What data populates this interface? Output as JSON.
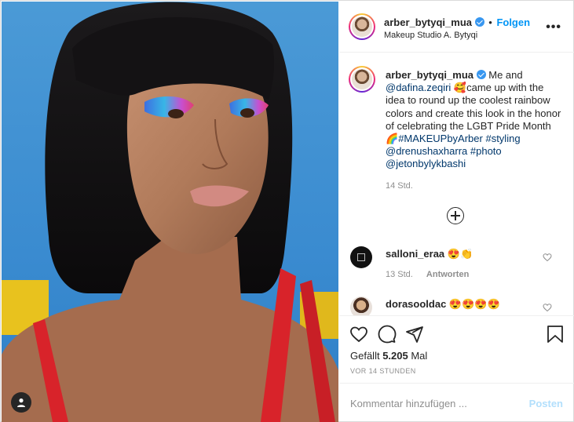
{
  "colors": {
    "accent": "#0095f6",
    "link": "#00376b",
    "muted": "#8e8e8e",
    "post_disabled": "#b2dffc",
    "photo_background": "#3b8fd0"
  },
  "header": {
    "username": "arber_bytyqi_mua",
    "verified_icon": "verified-badge-icon",
    "separator": "•",
    "follow_label": "Folgen",
    "location": "Makeup Studio A. Bytyqi",
    "more_label": "•••"
  },
  "caption": {
    "username": "arber_bytyqi_mua",
    "text_1": " Me and ",
    "mention_1": "@dafina.zeqiri",
    "emoji_1": "🥰",
    "text_2": "came up with the idea to round up the coolest rainbow colors and create this look in the honor of celebrating the LGBT Pride Month ",
    "emoji_2": "🌈",
    "hashtag_1": "#MAKEUPbyArber",
    "space_1": " ",
    "hashtag_2": "#styling",
    "space_2": " ",
    "mention_2": "@drenushaxharra",
    "space_3": " ",
    "hashtag_3": "#photo",
    "space_4": " ",
    "mention_3": "@jetonbylykbashi",
    "time": "14 Std."
  },
  "load_more_icon": "plus-circle-icon",
  "comments": [
    {
      "username": "salloni_eraa",
      "text": "😍👏",
      "time": "13 Std.",
      "reply_label": "Antworten"
    },
    {
      "username": "dorasooldac",
      "text": "😍😍😍😍"
    }
  ],
  "actions": {
    "like_icon": "heart-icon",
    "comment_icon": "comment-icon",
    "share_icon": "paper-plane-icon",
    "save_icon": "bookmark-icon",
    "likes_prefix": "Gefällt ",
    "likes_count": "5.205",
    "likes_suffix": " Mal",
    "posted_ago": "VOR 14 STUNDEN"
  },
  "comment_bar": {
    "placeholder": "Kommentar hinzufügen ...",
    "post_label": "Posten"
  }
}
